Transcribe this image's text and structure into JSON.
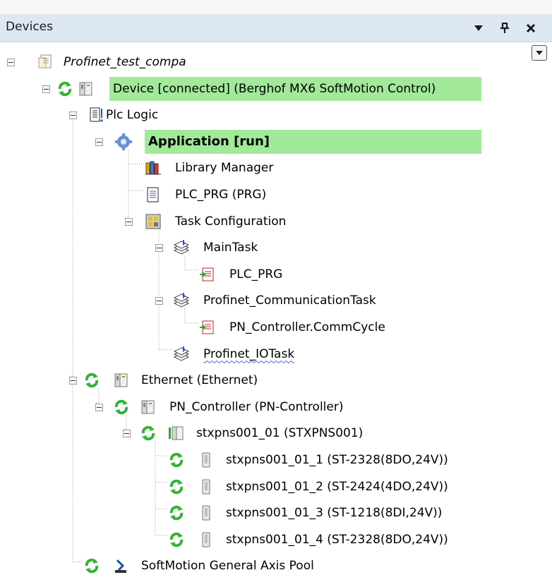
{
  "panel": {
    "title": "Devices",
    "buttons": {
      "menu_icon": "triangle-down-icon",
      "pin_icon": "pin-icon",
      "close_icon": "close-icon"
    }
  },
  "colors": {
    "highlight": "#a2e99a",
    "titlebar": "#dde8f4",
    "tree_lines": "#9a9a9a"
  },
  "tree": [
    {
      "level": 0,
      "label": "Profinet_test_compa",
      "italic": true,
      "icon": "project-document-icon",
      "expanded": true
    },
    {
      "level": 1,
      "label": "Device [connected] (Berghof MX6 SoftMotion Control)",
      "status_icon": "connected-refresh-icon",
      "icon": "device-module-icon",
      "highlight": true,
      "expanded": true
    },
    {
      "level": 2,
      "label": "Plc Logic",
      "icon": "plc-logic-icon",
      "expanded": true
    },
    {
      "level": 3,
      "label": "Application [run]",
      "bold": true,
      "icon": "application-gear-icon",
      "highlight": true,
      "expanded": true
    },
    {
      "level": 4,
      "label": "Library Manager",
      "icon": "library-books-icon"
    },
    {
      "level": 4,
      "label": "PLC_PRG (PRG)",
      "icon": "program-document-icon"
    },
    {
      "level": 4,
      "label": "Task Configuration",
      "icon": "task-configuration-icon",
      "expanded": true
    },
    {
      "level": 5,
      "label": "MainTask",
      "icon": "task-stack-icon",
      "expanded": true
    },
    {
      "level": 6,
      "label": "PLC_PRG",
      "icon": "program-call-icon"
    },
    {
      "level": 5,
      "label": "Profinet_CommunicationTask",
      "icon": "task-stack-icon",
      "expanded": true
    },
    {
      "level": 6,
      "label": "PN_Controller.CommCycle",
      "icon": "program-call-icon"
    },
    {
      "level": 5,
      "label": "Profinet_IOTask",
      "icon": "task-stack-icon",
      "spellcheck": true
    },
    {
      "level": 2,
      "label": "Ethernet (Ethernet)",
      "status_icon": "connected-refresh-icon",
      "icon": "device-module-icon",
      "expanded": true
    },
    {
      "level": 3,
      "label": "PN_Controller (PN-Controller)",
      "status_icon": "connected-refresh-icon",
      "icon": "device-module-icon",
      "expanded": true
    },
    {
      "level": 4,
      "label": "stxpns001_01 (STXPNS001)",
      "status_icon": "connected-refresh-icon",
      "icon": "io-coupler-icon",
      "expanded": true
    },
    {
      "level": 5,
      "label": "stxpns001_01_1 (ST-2328(8DO,24V))",
      "status_icon": "connected-refresh-icon",
      "icon": "io-module-icon"
    },
    {
      "level": 5,
      "label": "stxpns001_01_2 (ST-2424(4DO,24V))",
      "status_icon": "connected-refresh-icon",
      "icon": "io-module-icon"
    },
    {
      "level": 5,
      "label": "stxpns001_01_3 (ST-1218(8DI,24V))",
      "status_icon": "connected-refresh-icon",
      "icon": "io-module-icon"
    },
    {
      "level": 5,
      "label": "stxpns001_01_4 (ST-2328(8DO,24V))",
      "status_icon": "connected-refresh-icon",
      "icon": "io-module-icon"
    },
    {
      "level": 2,
      "label": "SoftMotion General Axis Pool",
      "status_icon": "connected-refresh-icon",
      "icon": "axis-pool-icon"
    }
  ]
}
